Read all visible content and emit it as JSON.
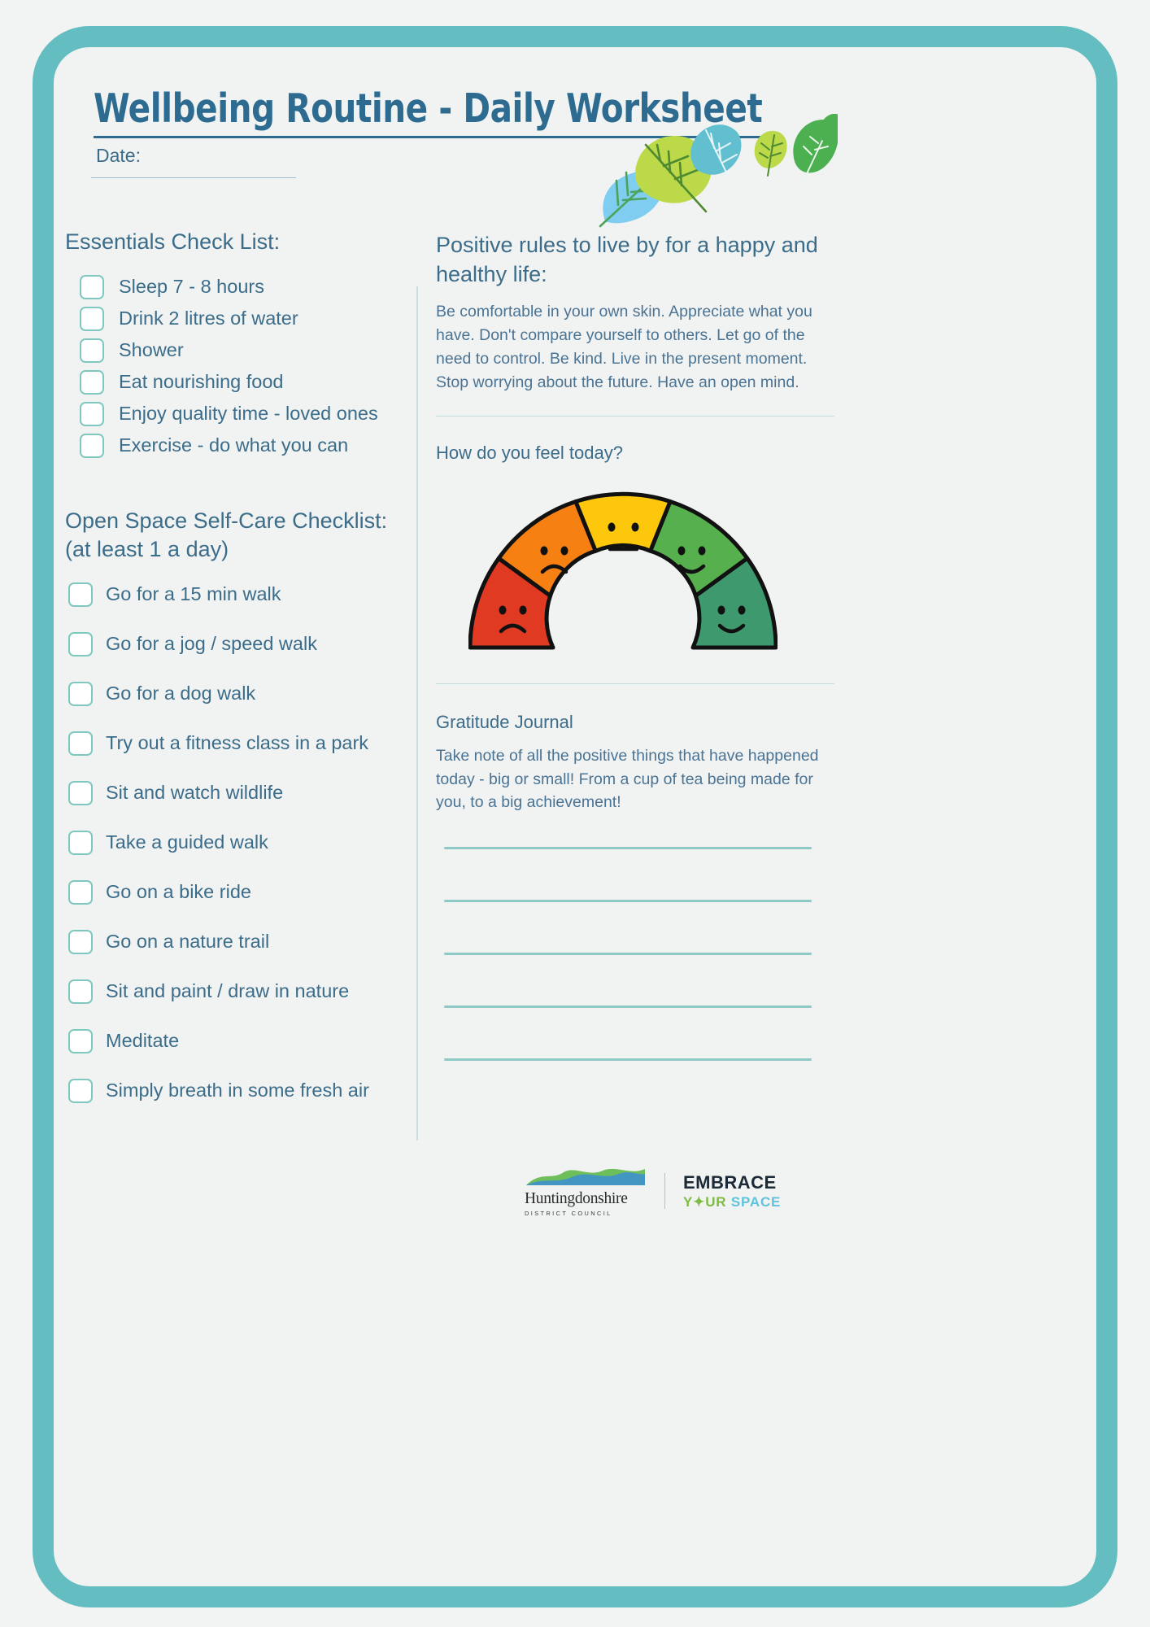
{
  "header": {
    "title": "Wellbeing Routine - Daily Worksheet",
    "date_label": "Date:"
  },
  "colors": {
    "frame": "#64bdc0",
    "page_bg": "#f1f3f2",
    "heading": "#3b6c8a",
    "title": "#2e6b91",
    "checkbox_border": "#7fc8bf",
    "rule": "#8fc9c6"
  },
  "essentials": {
    "heading": "Essentials Check List:",
    "items": [
      "Sleep 7 - 8 hours",
      "Drink 2 litres of water",
      "Shower",
      "Eat nourishing food",
      "Enjoy quality time - loved ones",
      "Exercise - do what you can"
    ]
  },
  "open_space": {
    "heading_line1": "Open Space Self-Care Checklist:",
    "heading_line2": "(at least 1 a day)",
    "items": [
      "Go for a 15 min walk",
      "Go for a jog / speed walk",
      "Go for a dog walk",
      "Try out a fitness class in a park",
      "Sit and watch wildlife",
      "Take a guided walk",
      "Go on a bike ride",
      "Go on a nature trail",
      "Sit and paint / draw in nature",
      "Meditate",
      "Simply breath in some fresh air"
    ]
  },
  "positive_rules": {
    "heading": "Positive rules to live by for a happy and healthy life:",
    "body": "Be comfortable in your own skin.  Appreciate what you have.  Don't compare yourself to others.  Let go of the need to control.  Be kind.  Live in the present moment.  Stop worrying about the future. Have an open mind."
  },
  "mood": {
    "heading": "How do you feel today?",
    "segments": [
      {
        "name": "very-sad",
        "color": "#e03a22",
        "face": "frown-deep"
      },
      {
        "name": "sad",
        "color": "#f68012",
        "face": "frown"
      },
      {
        "name": "neutral",
        "color": "#fdc70b",
        "face": "neutral"
      },
      {
        "name": "happy",
        "color": "#56b04d",
        "face": "smile"
      },
      {
        "name": "very-happy",
        "color": "#3e9a6e",
        "face": "smile-big"
      }
    ]
  },
  "gratitude": {
    "heading": "Gratitude Journal",
    "body": "Take note of all the positive things that have happened today - big or small!  From a cup of tea being made for you, to a big achievement!",
    "line_count": 5
  },
  "footer": {
    "council_name": "Huntingdonshire",
    "council_sub": "DISTRICT COUNCIL",
    "embrace_top": "EMBRACE",
    "embrace_your": "Y",
    "embrace_your_rest": "UR",
    "embrace_space": "SPACE"
  }
}
